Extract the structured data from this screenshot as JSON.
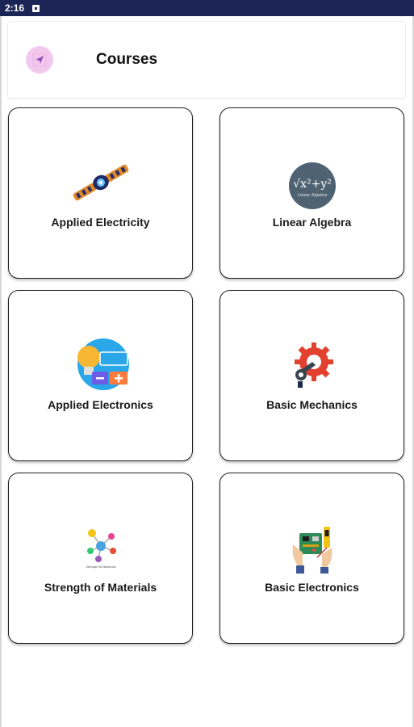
{
  "status_bar": {
    "time": "2:16"
  },
  "app_bar": {
    "title": "Courses",
    "logo_icon": "paper-plane-icon"
  },
  "courses": [
    {
      "label": "Applied Electricity",
      "icon": "cable-connector-icon"
    },
    {
      "label": "Linear Algebra",
      "icon": "sqrt-formula-icon",
      "icon_text": "√x²+y²",
      "icon_subtext": "Linear Algebra"
    },
    {
      "label": "Applied Electronics",
      "icon": "bulb-battery-icon"
    },
    {
      "label": "Basic Mechanics",
      "icon": "gear-wrench-icon"
    },
    {
      "label": "Strength of Materials",
      "icon": "molecule-icon",
      "icon_caption": "Strength of Materials"
    },
    {
      "label": "Basic Electronics",
      "icon": "circuit-board-icon"
    }
  ],
  "colors": {
    "status_bar": "#1c2456",
    "logo_bg": "#f3c8ef",
    "card_border": "#202020",
    "title_text": "#111111"
  }
}
